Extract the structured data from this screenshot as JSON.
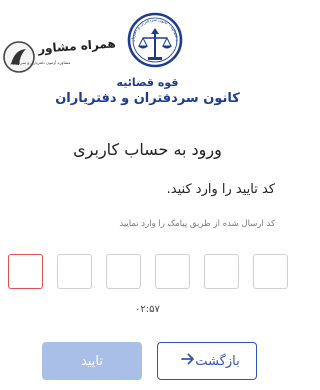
{
  "watermark": {
    "title": "همراه مشاور",
    "subtitle": "مشاوره آزمون دفتریاری و سردفتری"
  },
  "header": {
    "emblem_text": "قوه قضائیه - کانون سردفتران و دفتریاران",
    "org_name": "قوه قضائیه",
    "org_sub": "کانون سردفتران و دفتریاران"
  },
  "page": {
    "title": "ورود به حساب کاربری",
    "enter_code": "کد تایید را وارد کنید.",
    "sent_code": "کد ارسال شده از طریق پیامک را وارد نمایید"
  },
  "otp": {
    "digits": 6,
    "values": [
      "",
      "",
      "",
      "",
      "",
      ""
    ]
  },
  "timer": "۰۲:۵۷",
  "buttons": {
    "back_label": "بازگشت",
    "confirm_label": "تایید"
  },
  "colors": {
    "brand_blue": "#1c3d8f",
    "button_blue": "#2f55b8",
    "disabled_blue": "#a9bfe8",
    "active_border": "#e05252"
  }
}
